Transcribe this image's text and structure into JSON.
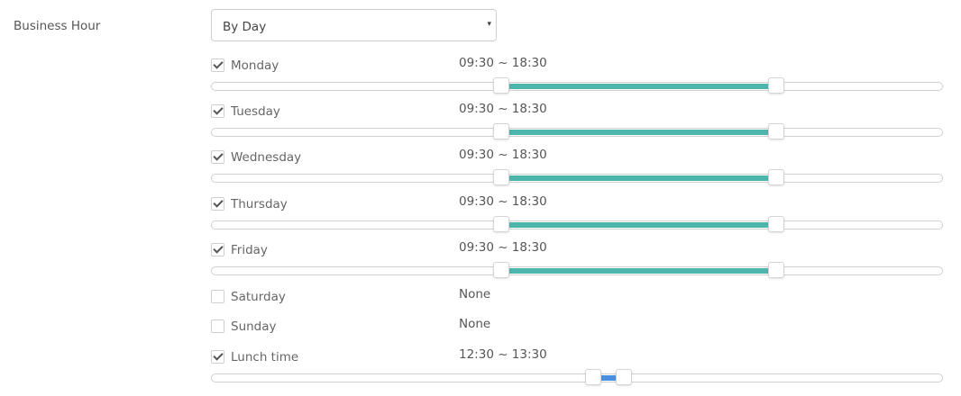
{
  "field_label": "Business Hour",
  "select": {
    "value": "By Day",
    "caret": "▾"
  },
  "days": [
    {
      "label": "Monday",
      "checked": true,
      "time": "09:30 ~ 18:30",
      "start_min": 570,
      "end_min": 1110,
      "slider": true
    },
    {
      "label": "Tuesday",
      "checked": true,
      "time": "09:30 ~ 18:30",
      "start_min": 570,
      "end_min": 1110,
      "slider": true
    },
    {
      "label": "Wednesday",
      "checked": true,
      "time": "09:30 ~ 18:30",
      "start_min": 570,
      "end_min": 1110,
      "slider": true
    },
    {
      "label": "Thursday",
      "checked": true,
      "time": "09:30 ~ 18:30",
      "start_min": 570,
      "end_min": 1110,
      "slider": true
    },
    {
      "label": "Friday",
      "checked": true,
      "time": "09:30 ~ 18:30",
      "start_min": 570,
      "end_min": 1110,
      "slider": true
    },
    {
      "label": "Saturday",
      "checked": false,
      "time": "None",
      "slider": false
    },
    {
      "label": "Sunday",
      "checked": false,
      "time": "None",
      "slider": false
    },
    {
      "label": "Lunch time",
      "checked": true,
      "time": "12:30 ~ 13:30",
      "start_min": 750,
      "end_min": 810,
      "slider": true,
      "lunch": true
    }
  ],
  "colors": {
    "business_fill": "#4db6ac",
    "lunch_fill": "#4a90e2"
  }
}
